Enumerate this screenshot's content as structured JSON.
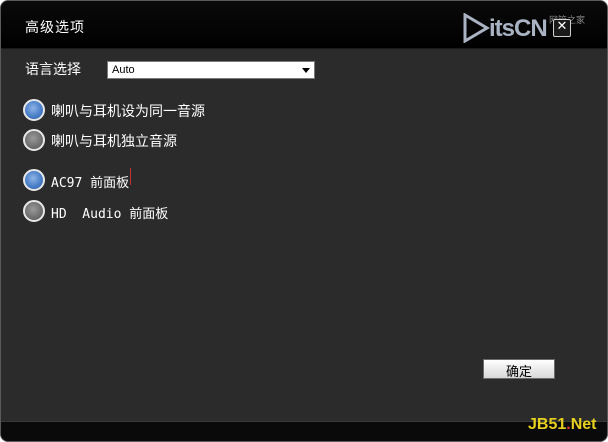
{
  "window": {
    "title": "高级选项",
    "close_symbol": "✕"
  },
  "watermark": {
    "logo_text": "itsCN",
    "logo_sub": "网管之家",
    "bottom_prefix": "JB51",
    "bottom_dot": ".",
    "bottom_suffix": "Net"
  },
  "language": {
    "label": "语言选择",
    "selected": "Auto"
  },
  "speaker_options": [
    {
      "label": "喇叭与耳机设为同一音源",
      "selected": true
    },
    {
      "label": "喇叭与耳机独立音源",
      "selected": false
    }
  ],
  "panel_options": [
    {
      "label": "AC97 前面板",
      "selected": true
    },
    {
      "label": "HD  Audio 前面板",
      "selected": false
    }
  ],
  "buttons": {
    "ok": "确定"
  },
  "colors": {
    "background": "#2b2b2b",
    "titlebar": "#000000",
    "radio_selected": "#4a7fc8",
    "radio_unselected": "#6e6e6e"
  }
}
